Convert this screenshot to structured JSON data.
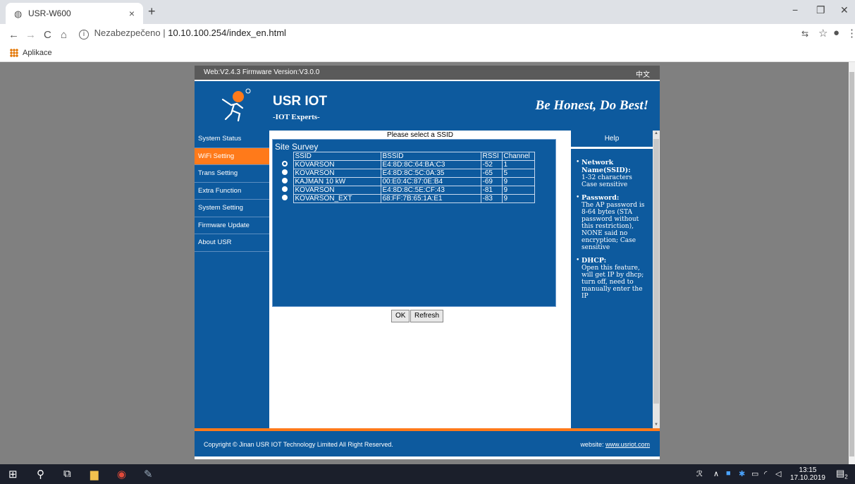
{
  "browser": {
    "tab_title": "USR-W600",
    "tab_close": "×",
    "new_tab": "+",
    "url_label": "Nezabezpečeno",
    "url_sep": "|",
    "url": "10.10.100.254/index_en.html",
    "bookmark_apps": "Aplikace",
    "win_min": "−",
    "win_max": "❐",
    "win_close": "✕",
    "nav_back": "←",
    "nav_forward": "→",
    "nav_reload": "C",
    "nav_home": "⌂",
    "star": "☆",
    "menu": "⋮",
    "translate": "⇆",
    "account": "●"
  },
  "page": {
    "top_version": "Web:V2.4.3    Firmware Version:V3.0.0",
    "lang_link": "中文",
    "brand": "USR IOT",
    "brand_sub": "-IOT Experts-",
    "motto": "Be Honest, Do Best!",
    "sidebar": [
      {
        "label": "System Status",
        "active": false
      },
      {
        "label": "WiFi Setting",
        "active": true
      },
      {
        "label": "Trans Setting",
        "active": false
      },
      {
        "label": "Extra Function",
        "active": false
      },
      {
        "label": "System Setting",
        "active": false
      },
      {
        "label": "Firmware Update",
        "active": false
      },
      {
        "label": "About USR",
        "active": false
      }
    ],
    "select_title": "Please select a SSID",
    "survey_title": "Site Survey",
    "columns": [
      "SSID",
      "BSSID",
      "RSSI",
      "Channel"
    ],
    "rows": [
      {
        "ssid": "KOVARSON",
        "bssid": "E4:8D:8C:64:BA:C3",
        "rssi": "-52",
        "channel": "1",
        "selected": true
      },
      {
        "ssid": "KOVARSON",
        "bssid": "E4:8D:8C:5C:0A:35",
        "rssi": "-65",
        "channel": "5",
        "selected": false
      },
      {
        "ssid": "KAJMAN 10 kW",
        "bssid": "00:E0:4C:87:0E:B4",
        "rssi": "-69",
        "channel": "9",
        "selected": false
      },
      {
        "ssid": "KOVARSON",
        "bssid": "E4:8D:8C:5E:CF:43",
        "rssi": "-81",
        "channel": "9",
        "selected": false
      },
      {
        "ssid": "KOVARSON_EXT",
        "bssid": "68:FF:7B:65:1A:E1",
        "rssi": "-83",
        "channel": "9",
        "selected": false
      }
    ],
    "ok_label": "OK",
    "refresh_label": "Refresh",
    "help_title": "Help",
    "help": [
      {
        "title": "Network Name(SSID):",
        "text": "1-32 characters Case sensitive"
      },
      {
        "title": "Password:",
        "text": "The AP password is 8-64 bytes (STA password without this restriction), NONE said no encryption; Case sensitive"
      },
      {
        "title": "DHCP:",
        "text": "Open this feature, will get IP by dhcp; turn off, need to manually enter the IP"
      }
    ],
    "copyright": "Copyright © Jinan USR IOT Technology Limited All Right Reserved.",
    "website_label": "website:",
    "website": "www.usriot.com"
  },
  "taskbar": {
    "time": "13:15",
    "date": "17.10.2019",
    "notif_count": "2"
  },
  "colors": {
    "brand_blue": "#0d5a9e",
    "accent_orange": "#ff7a1a",
    "backdrop_gray": "#808080"
  }
}
